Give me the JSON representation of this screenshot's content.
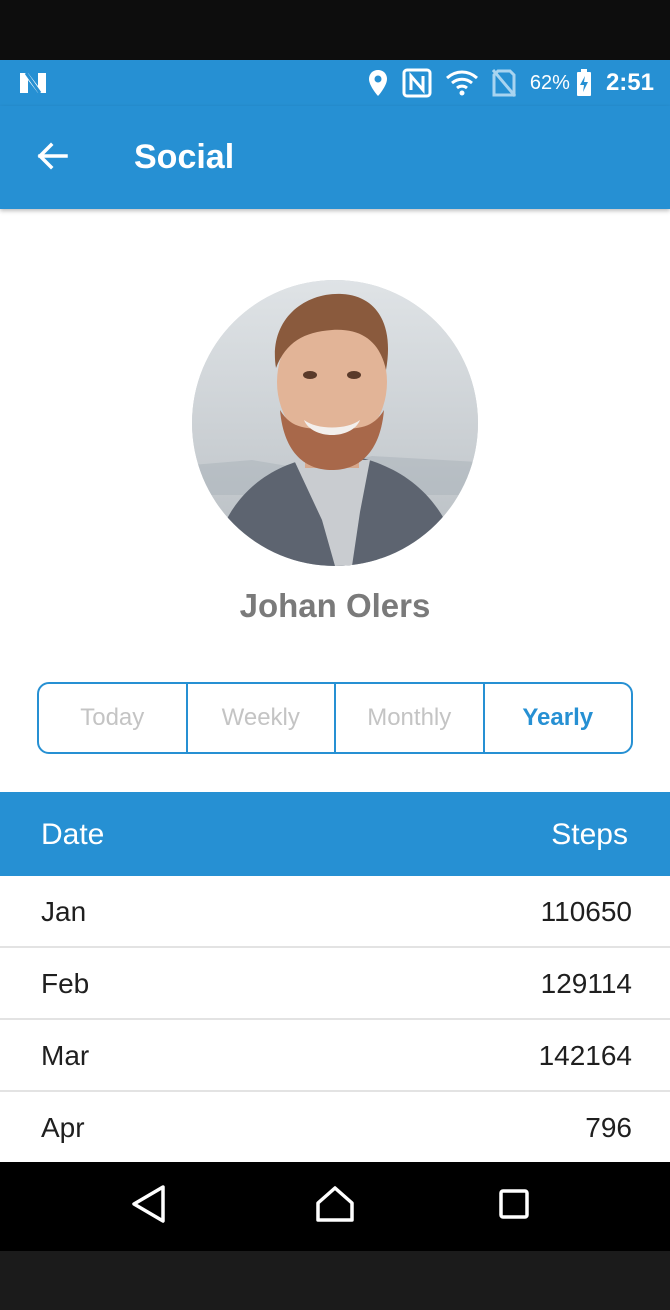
{
  "status_bar": {
    "battery_percent": "62%",
    "time": "2:51",
    "icons": [
      "notification-n-icon",
      "location-icon",
      "nfc-icon",
      "wifi-icon",
      "no-sim-icon",
      "battery-charging-icon"
    ]
  },
  "app_bar": {
    "title": "Social",
    "back_icon": "arrow-left-icon"
  },
  "profile": {
    "name": "Johan Olers"
  },
  "period_tabs": {
    "items": [
      {
        "label": "Today",
        "active": false
      },
      {
        "label": "Weekly",
        "active": false
      },
      {
        "label": "Monthly",
        "active": false
      },
      {
        "label": "Yearly",
        "active": true
      }
    ]
  },
  "table": {
    "headers": {
      "date": "Date",
      "steps": "Steps"
    },
    "rows": [
      {
        "date": "Jan",
        "steps": "110650"
      },
      {
        "date": "Feb",
        "steps": "129114"
      },
      {
        "date": "Mar",
        "steps": "142164"
      },
      {
        "date": "Apr",
        "steps": "796"
      }
    ]
  },
  "nav_bar": {
    "icons": [
      "back-triangle-icon",
      "home-icon",
      "recents-square-icon"
    ]
  },
  "colors": {
    "primary": "#2690d3",
    "tab_inactive_text": "#c4c4c4",
    "name_text": "#7a7a7a"
  }
}
